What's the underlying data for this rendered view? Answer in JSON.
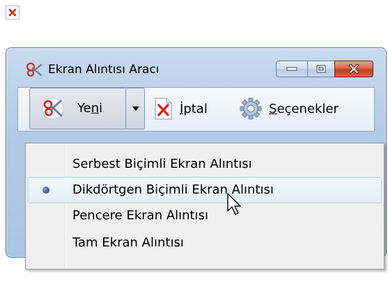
{
  "window": {
    "title": "Ekran Alıntısı Aracı"
  },
  "toolbar": {
    "new_button": {
      "label_prefix": "Ye",
      "label_underlined": "n",
      "label_suffix": "i"
    },
    "cancel_button": {
      "label_underlined": "İ",
      "label_suffix": "ptal"
    },
    "options_button": {
      "label_underlined": "S",
      "label_suffix": "eçenekler"
    }
  },
  "menu": {
    "items": [
      {
        "label": "Serbest Biçimli Ekran Alıntısı",
        "selected": false
      },
      {
        "label": "Dikdörtgen Biçimli Ekran Alıntısı",
        "selected": true
      },
      {
        "label": "Pencere Ekran Alıntısı",
        "selected": false
      },
      {
        "label": "Tam Ekran Alıntısı",
        "selected": false
      }
    ]
  },
  "icons": {
    "corner": "close-x-icon",
    "title": "scissors-icon",
    "new": "scissors-icon",
    "cancel": "cancel-document-icon",
    "options": "gear-icon",
    "dropdown": "chevron-down-icon",
    "selected_marker": "radio-bullet-icon",
    "cursor": "mouse-pointer-icon"
  },
  "colors": {
    "frame": "#b3cbe6",
    "close_button": "#c13f21",
    "menu_background": "#f0f0f0",
    "selection": "#e1eff9",
    "bullet": "#3c4596"
  }
}
